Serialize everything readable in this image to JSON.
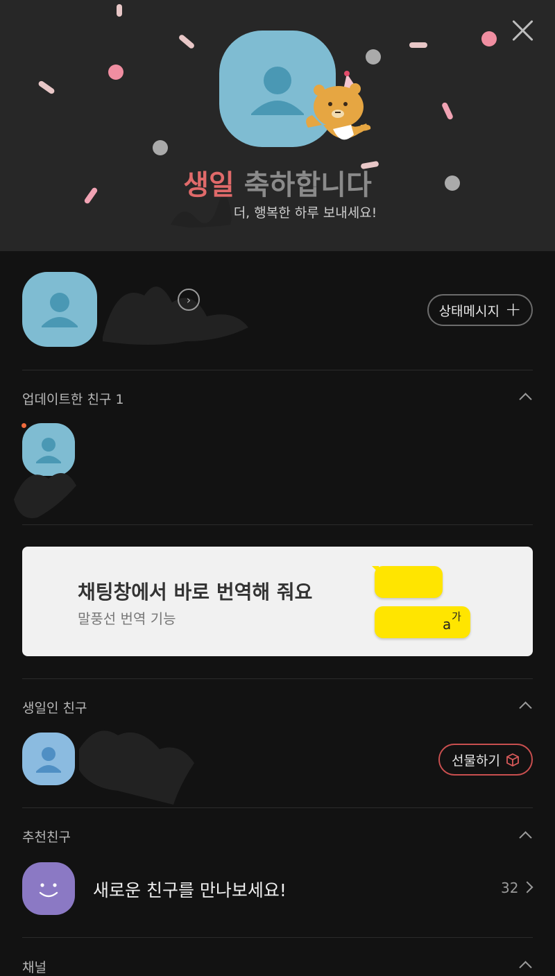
{
  "banner": {
    "title_highlight": "생일",
    "title_rest": " 축하합니다",
    "subtitle": "더, 행복한 하루 보내세요!"
  },
  "profile": {
    "status_button_label": "상태메시지",
    "status_button_plus": "+"
  },
  "sections": {
    "updated_friends": "업데이트한 친구 1",
    "birthday_friends": "생일인 친구",
    "recommended_friends": "추천친구",
    "channel": "채널"
  },
  "ad": {
    "title": "채팅창에서 바로 번역해 줘요",
    "subtitle": "말풍선 번역 기능",
    "bubble_glyph_latin": "a",
    "bubble_glyph_korean": "가"
  },
  "birthday_friend": {
    "gift_button_label": "선물하기"
  },
  "recommended": {
    "text": "새로운 친구를 만나보세요!",
    "count": "32"
  },
  "colors": {
    "background": "#121212",
    "banner": "#272727",
    "avatar_blue": "#7fbcd2",
    "accent_red": "#e06a6a",
    "bubble_yellow": "#ffe500",
    "recommend_purple": "#8b79c4"
  },
  "icons": [
    "close-icon",
    "chevron-right-icon",
    "plus-icon",
    "caret-up-icon",
    "gift-icon",
    "smiley-icon",
    "party-character-icon",
    "person-icon"
  ]
}
